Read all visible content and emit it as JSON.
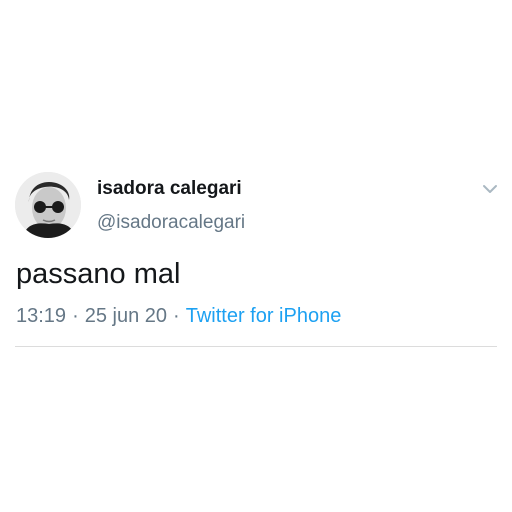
{
  "user": {
    "display_name": "isadora calegari",
    "handle": "@isadoracalegari",
    "avatar_icon": "user-avatar"
  },
  "tweet": {
    "text": "passano mal",
    "time": "13:19",
    "separator": "·",
    "date": "25 jun 20",
    "source": "Twitter for iPhone"
  },
  "menu": {
    "icon": "chevron-down-icon"
  },
  "colors": {
    "text_primary": "#14171a",
    "text_secondary": "#657786",
    "link": "#1da1f2",
    "divider": "#dcdcdc"
  }
}
